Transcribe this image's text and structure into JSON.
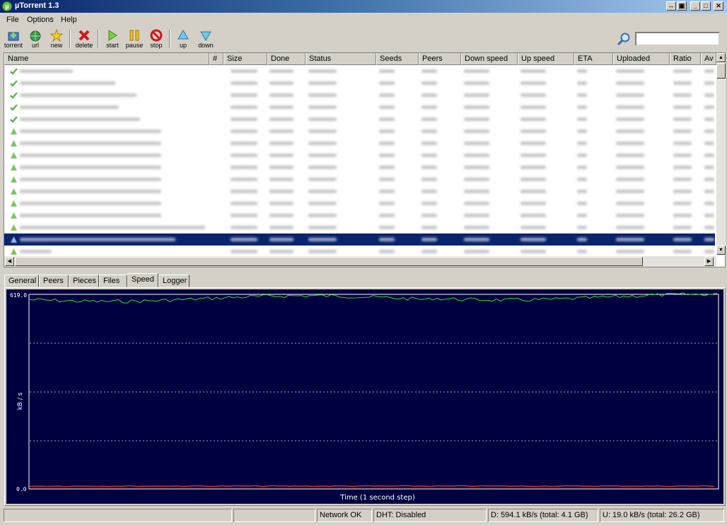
{
  "window": {
    "title": "µTorrent 1.3",
    "icon": "utorrent-logo-icon"
  },
  "menu": {
    "file": "File",
    "options": "Options",
    "help": "Help"
  },
  "toolbar": {
    "torrent": "torrent",
    "url": "url",
    "new": "new",
    "delete": "delete",
    "start": "start",
    "pause": "pause",
    "stop": "stop",
    "up": "up",
    "down": "down",
    "search_value": ""
  },
  "columns": [
    "Name",
    "#",
    "Size",
    "Done",
    "Status",
    "Seeds",
    "Peers",
    "Down speed",
    "Up speed",
    "ETA",
    "Uploaded",
    "Ratio",
    "Av"
  ],
  "tabs": [
    "General",
    "Peers",
    "Pieces",
    "Files",
    "Speed",
    "Logger"
  ],
  "active_tab": "Speed",
  "graph": {
    "y_max_label": "619.0",
    "y_min_label": "0.0",
    "y_axis_label": "kB / s",
    "x_axis_label": "Time (1 second step)",
    "colors": {
      "background": "#000040",
      "download": "#28e028",
      "upload": "#e02828",
      "grid": "#9aa0c0"
    }
  },
  "status": {
    "network": "Network OK",
    "dht": "DHT: Disabled",
    "download": "D: 594.1 kB/s  (total: 4.1 GB)",
    "upload": "U: 19.0 kB/s  (total: 26.2 GB)"
  }
}
